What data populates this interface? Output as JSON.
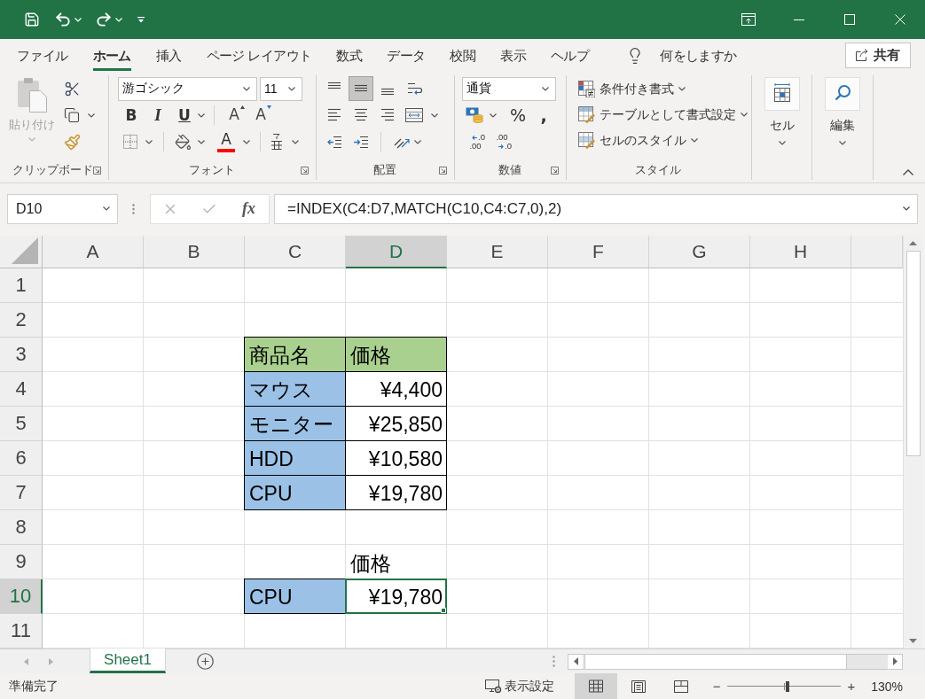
{
  "ribbon_tabs": [
    {
      "label": "ファイル",
      "selected": false
    },
    {
      "label": "ホーム",
      "selected": true
    },
    {
      "label": "挿入",
      "selected": false
    },
    {
      "label": "ページ レイアウト",
      "selected": false
    },
    {
      "label": "数式",
      "selected": false
    },
    {
      "label": "データ",
      "selected": false
    },
    {
      "label": "校閲",
      "selected": false
    },
    {
      "label": "表示",
      "selected": false
    },
    {
      "label": "ヘルプ",
      "selected": false
    }
  ],
  "tell_me": {
    "label": "何をしますか"
  },
  "share_button": {
    "label": "共有"
  },
  "ribbon": {
    "clipboard": {
      "label": "クリップボード",
      "paste": {
        "label": "貼り付け",
        "disabled": true
      }
    },
    "font": {
      "label": "フォント",
      "font_name": "游ゴシック",
      "font_size": "11",
      "style_buttons": [
        {
          "kind": "bold",
          "glyph": "B"
        },
        {
          "kind": "italic",
          "glyph": "I"
        },
        {
          "kind": "underline",
          "glyph": "U"
        }
      ],
      "size_buttons": [
        {
          "kind": "grow",
          "glyph": "A"
        },
        {
          "kind": "shrink",
          "glyph": "A"
        }
      ],
      "font_color": {
        "glyph": "A",
        "color": "#ff0000"
      }
    },
    "alignment": {
      "label": "配置",
      "vertical": [
        {
          "kind": "top",
          "selected": false
        },
        {
          "kind": "middle",
          "selected": true
        },
        {
          "kind": "bottom",
          "selected": false
        }
      ],
      "horizontal": [
        {
          "kind": "left",
          "selected": false
        },
        {
          "kind": "center",
          "selected": false
        },
        {
          "kind": "right",
          "selected": false
        }
      ]
    },
    "number": {
      "label": "数値",
      "format": "通貨",
      "percent_glyph": "%",
      "comma_glyph": ",",
      "decimal_buttons": [
        {
          "kind": "increase",
          "top": ".0",
          "bottom": ".00"
        },
        {
          "kind": "decrease",
          "top": ".00",
          "bottom": ".0"
        }
      ]
    },
    "styles": {
      "label": "スタイル",
      "commands": [
        {
          "kind": "conditional",
          "label": "条件付き書式"
        },
        {
          "kind": "table",
          "label": "テーブルとして書式設定"
        },
        {
          "kind": "cell_style",
          "label": "セルのスタイル"
        }
      ]
    },
    "cells": {
      "label": "セル"
    },
    "editing": {
      "label": "編集"
    }
  },
  "formula_bar": {
    "name_box": "D10",
    "function_glyph": "fx",
    "formula": "=INDEX(C4:D7,MATCH(C10,C4:C7,0),2)"
  },
  "sheet": {
    "columns": [
      {
        "label": "A",
        "selected": false
      },
      {
        "label": "B",
        "selected": false
      },
      {
        "label": "C",
        "selected": false
      },
      {
        "label": "D",
        "selected": true
      },
      {
        "label": "E",
        "selected": false
      },
      {
        "label": "F",
        "selected": false
      },
      {
        "label": "G",
        "selected": false
      },
      {
        "label": "H",
        "selected": false
      }
    ],
    "rows": [
      {
        "label": "1",
        "selected": false
      },
      {
        "label": "2",
        "selected": false
      },
      {
        "label": "3",
        "selected": false,
        "column_c": {
          "kind": "text",
          "text": "商品名",
          "color": "#a9d08e",
          "bordered": true,
          "selected": false
        },
        "column_d": {
          "kind": "text",
          "text": "価格",
          "color": "#a9d08e",
          "bordered": true,
          "selected": false
        }
      },
      {
        "label": "4",
        "selected": false,
        "column_c": {
          "kind": "text",
          "text": "マウス",
          "color": "#9bc2e6",
          "bordered": true,
          "selected": false
        },
        "column_d": {
          "kind": "currency",
          "text": "¥4,400",
          "bordered": true,
          "selected": false
        }
      },
      {
        "label": "5",
        "selected": false,
        "column_c": {
          "kind": "text",
          "text": "モニター",
          "color": "#9bc2e6",
          "bordered": true,
          "selected": false
        },
        "column_d": {
          "kind": "currency",
          "text": "¥25,850",
          "bordered": true,
          "selected": false
        }
      },
      {
        "label": "6",
        "selected": false,
        "column_c": {
          "kind": "text",
          "text": "HDD",
          "color": "#9bc2e6",
          "bordered": true,
          "selected": false
        },
        "column_d": {
          "kind": "currency",
          "text": "¥10,580",
          "bordered": true,
          "selected": false
        }
      },
      {
        "label": "7",
        "selected": false,
        "column_c": {
          "kind": "text",
          "text": "CPU",
          "color": "#9bc2e6",
          "bordered": true,
          "selected": false
        },
        "column_d": {
          "kind": "currency",
          "text": "¥19,780",
          "bordered": true,
          "selected": false
        }
      },
      {
        "label": "8",
        "selected": false
      },
      {
        "label": "9",
        "selected": false,
        "column_d": {
          "kind": "text",
          "text": "価格",
          "bordered": false,
          "selected": false
        }
      },
      {
        "label": "10",
        "selected": true,
        "column_c": {
          "kind": "text",
          "text": "CPU",
          "color": "#9bc2e6",
          "bordered": true,
          "selected": false
        },
        "column_d": {
          "kind": "currency",
          "text": "¥19,780",
          "bordered": true,
          "selected": true
        }
      },
      {
        "label": "11",
        "selected": false
      }
    ]
  },
  "sheet_tabs": [
    {
      "label": "Sheet1",
      "selected": true
    }
  ],
  "status_bar": {
    "status": "準備完了",
    "display_settings": "表示設定",
    "views": [
      {
        "kind": "normal",
        "selected": true
      },
      {
        "kind": "page_layout",
        "selected": false
      },
      {
        "kind": "page_break",
        "selected": false
      }
    ],
    "zoom": {
      "zoom_out": "−",
      "zoom_in": "+",
      "level": 0.53,
      "reading": "130%"
    }
  }
}
